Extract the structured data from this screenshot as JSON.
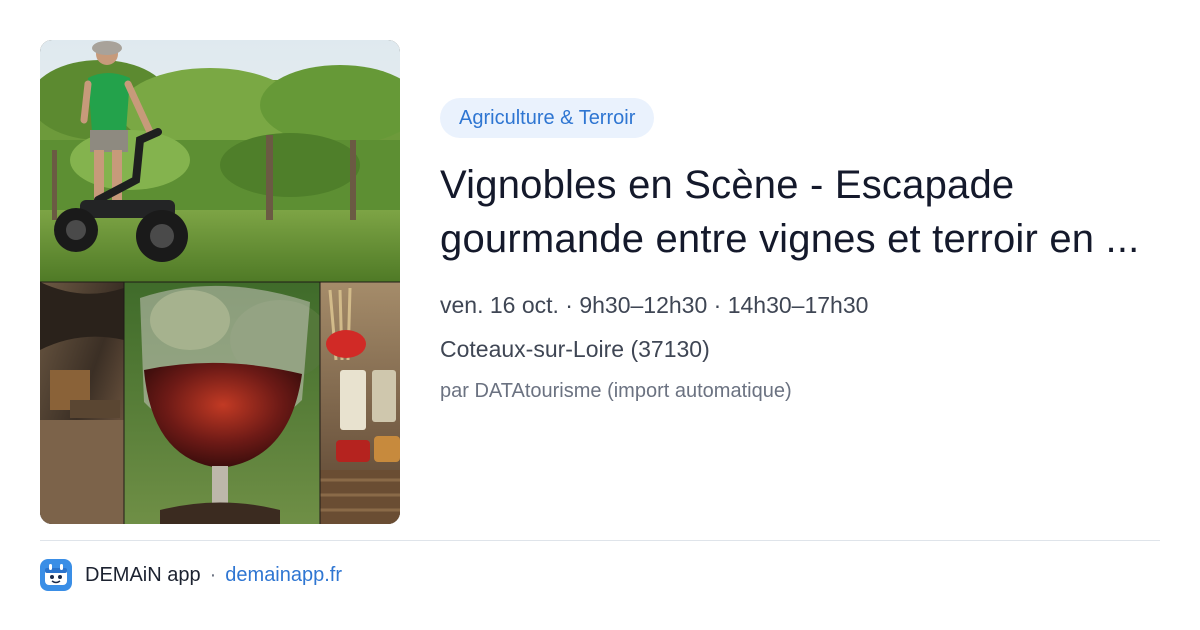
{
  "card": {
    "category_tag": "Agriculture & Terroir",
    "title": "Vignobles en Scène - Escapade gourmande entre vignes et terroir en ...",
    "date_line": "ven. 16 oct. · 9h30–12h30 · 14h30–17h30",
    "location": "Coteaux-sur-Loire (37130)",
    "source": "par DATAtourisme (import automatique)"
  },
  "footer": {
    "app_name": "DEMAiN app",
    "separator": "·",
    "app_url": "demainapp.fr",
    "app_icon": "demain-app-icon"
  },
  "colors": {
    "accent": "#2f76d2",
    "tag_background": "#eaf2fd",
    "title": "#14192b",
    "meta": "#3f4654",
    "muted": "#6b7281"
  }
}
